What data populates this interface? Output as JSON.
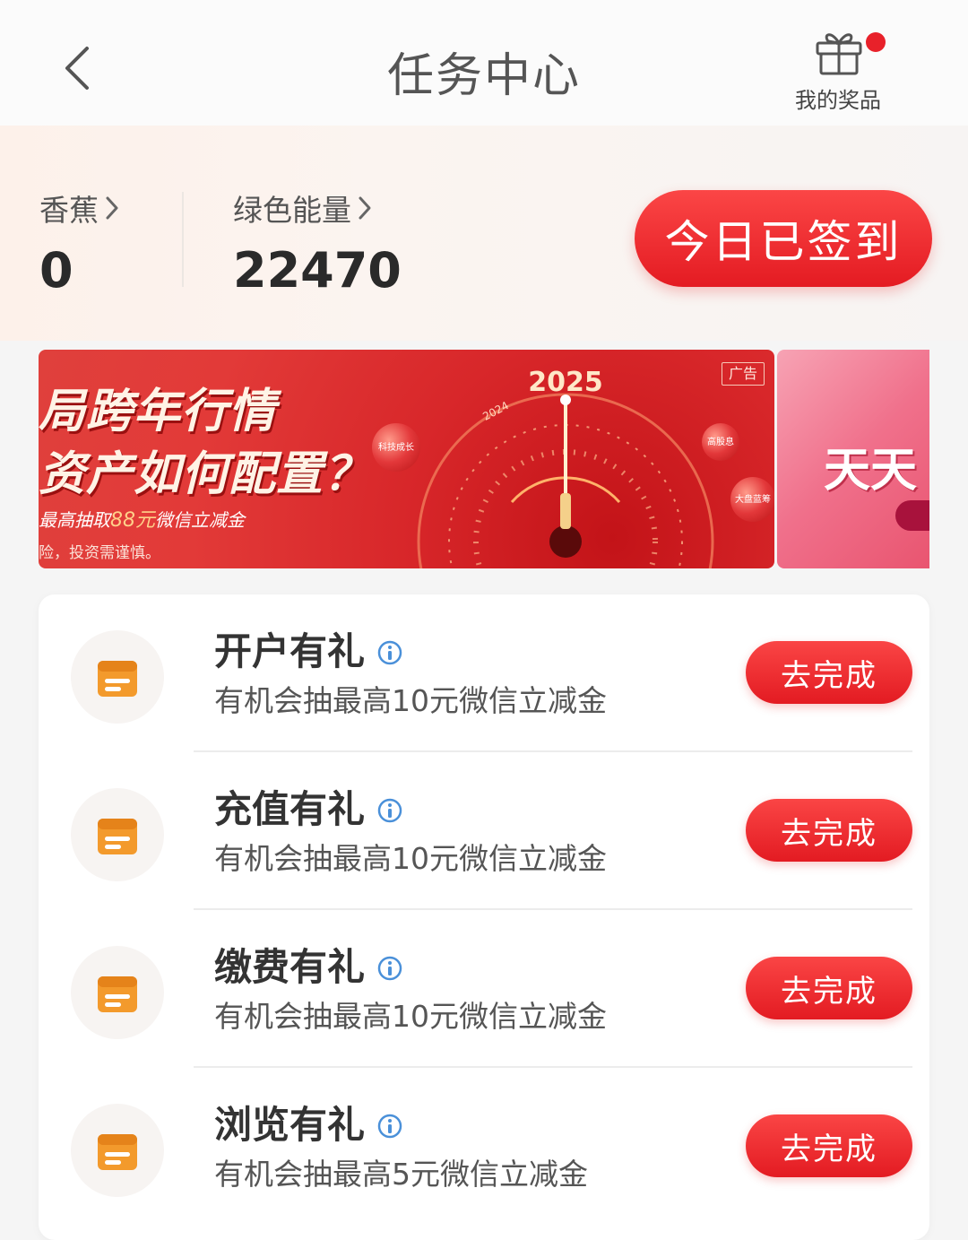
{
  "header": {
    "title": "任务中心",
    "prizes_label": "我的奖品"
  },
  "stats": [
    {
      "label": "香蕉",
      "value": "0"
    },
    {
      "label": "绿色能量",
      "value": "22470"
    }
  ],
  "signin_button": "今日已签到",
  "banner": {
    "line1": "局跨年行情",
    "line2": "资产如何配置？",
    "line3_prefix": "最高抽取",
    "line3_highlight": "88元",
    "line3_suffix": "微信立减金",
    "line4": "险，投资需谨慎。",
    "ad_tag": "广告",
    "year_main": "2025",
    "year_side": "2024",
    "bubble_1": "科技成长",
    "bubble_2": "高股息",
    "bubble_3": "大盘蓝筹"
  },
  "banner2": {
    "text": "天天"
  },
  "tasks": [
    {
      "title": "开户有礼",
      "desc": "有机会抽最高10元微信立减金",
      "button": "去完成"
    },
    {
      "title": "充值有礼",
      "desc": "有机会抽最高10元微信立减金",
      "button": "去完成"
    },
    {
      "title": "缴费有礼",
      "desc": "有机会抽最高10元微信立减金",
      "button": "去完成"
    },
    {
      "title": "浏览有礼",
      "desc": "有机会抽最高5元微信立减金",
      "button": "去完成"
    }
  ],
  "colors": {
    "primary_red": "#e41b22",
    "icon_orange": "#f39a2c",
    "info_blue": "#4a90d9"
  }
}
